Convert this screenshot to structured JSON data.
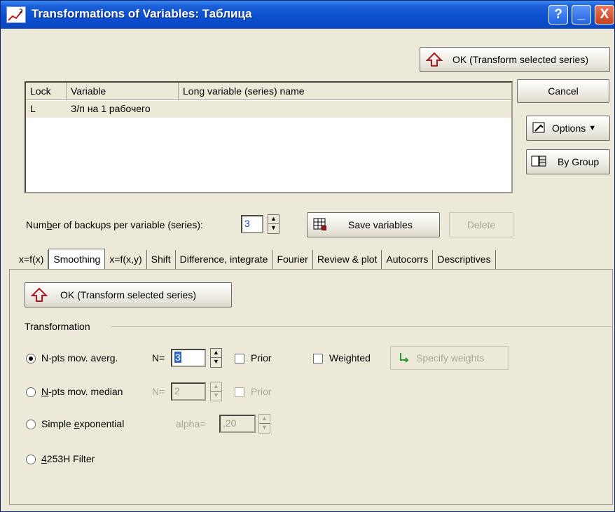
{
  "window": {
    "title": "Transformations of Variables: Таблица",
    "help_btn": "?",
    "min_btn": "_",
    "close_btn": "X"
  },
  "buttons": {
    "ok_top": "OK (Transform selected series)",
    "cancel": "Cancel",
    "options": "Options",
    "options_arrow": "▼",
    "by_group": "By Group",
    "save_variables": "Save variables",
    "delete": "Delete",
    "ok_panel": "OK (Transform selected series)",
    "specify_weights": "Specify weights"
  },
  "list": {
    "columns": [
      "Lock",
      "Variable",
      "Long variable (series) name"
    ],
    "rows": [
      {
        "lock": "L",
        "variable": "З/п на 1 рабочего",
        "long_name": ""
      }
    ]
  },
  "backups": {
    "label_pre": "Num",
    "label_ul": "b",
    "label_post": "er of backups per variable (series):",
    "value": "3"
  },
  "tabs": [
    {
      "label": "x=f(x)",
      "active": false
    },
    {
      "label": "Smoothing",
      "active": true
    },
    {
      "label": "x=f(x,y)",
      "active": false
    },
    {
      "label": "Shift",
      "active": false
    },
    {
      "label": "Difference, integrate",
      "active": false
    },
    {
      "label": "Fourier",
      "active": false
    },
    {
      "label": "Review & plot",
      "active": false
    },
    {
      "label": "Autocorrs",
      "active": false
    },
    {
      "label": "Descriptives",
      "active": false
    }
  ],
  "transformation": {
    "group_label": "Transformation",
    "npts_avg": {
      "label": "N-pts mov. averg.",
      "n_label": "N=",
      "n_value": "3",
      "prior_label": "Prior",
      "checked": true
    },
    "weighted_label": "Weighted",
    "npts_median": {
      "label_ul": "N",
      "label_post": "-pts mov. median",
      "n_label": "N=",
      "n_value": "2",
      "prior_label": "Prior",
      "checked": false
    },
    "simple_exp": {
      "label_pre": "Simple ",
      "label_ul": "e",
      "label_post": "xponential",
      "alpha_label": "alpha=",
      "alpha_value": ",20",
      "checked": false
    },
    "filter": {
      "label_ul": "4",
      "label_post": "253H Filter",
      "checked": false
    }
  }
}
